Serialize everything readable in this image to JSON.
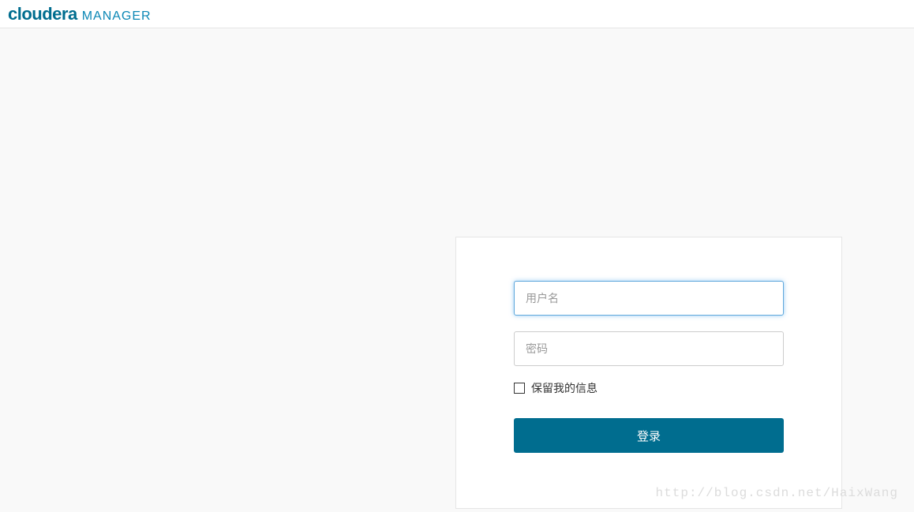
{
  "header": {
    "logo_brand": "cloudera",
    "logo_product": "MANAGER"
  },
  "login": {
    "username_placeholder": "用户名",
    "username_value": "",
    "password_placeholder": "密码",
    "password_value": "",
    "remember_label": "保留我的信息",
    "submit_label": "登录"
  },
  "watermark": "http://blog.csdn.net/HaixWang"
}
